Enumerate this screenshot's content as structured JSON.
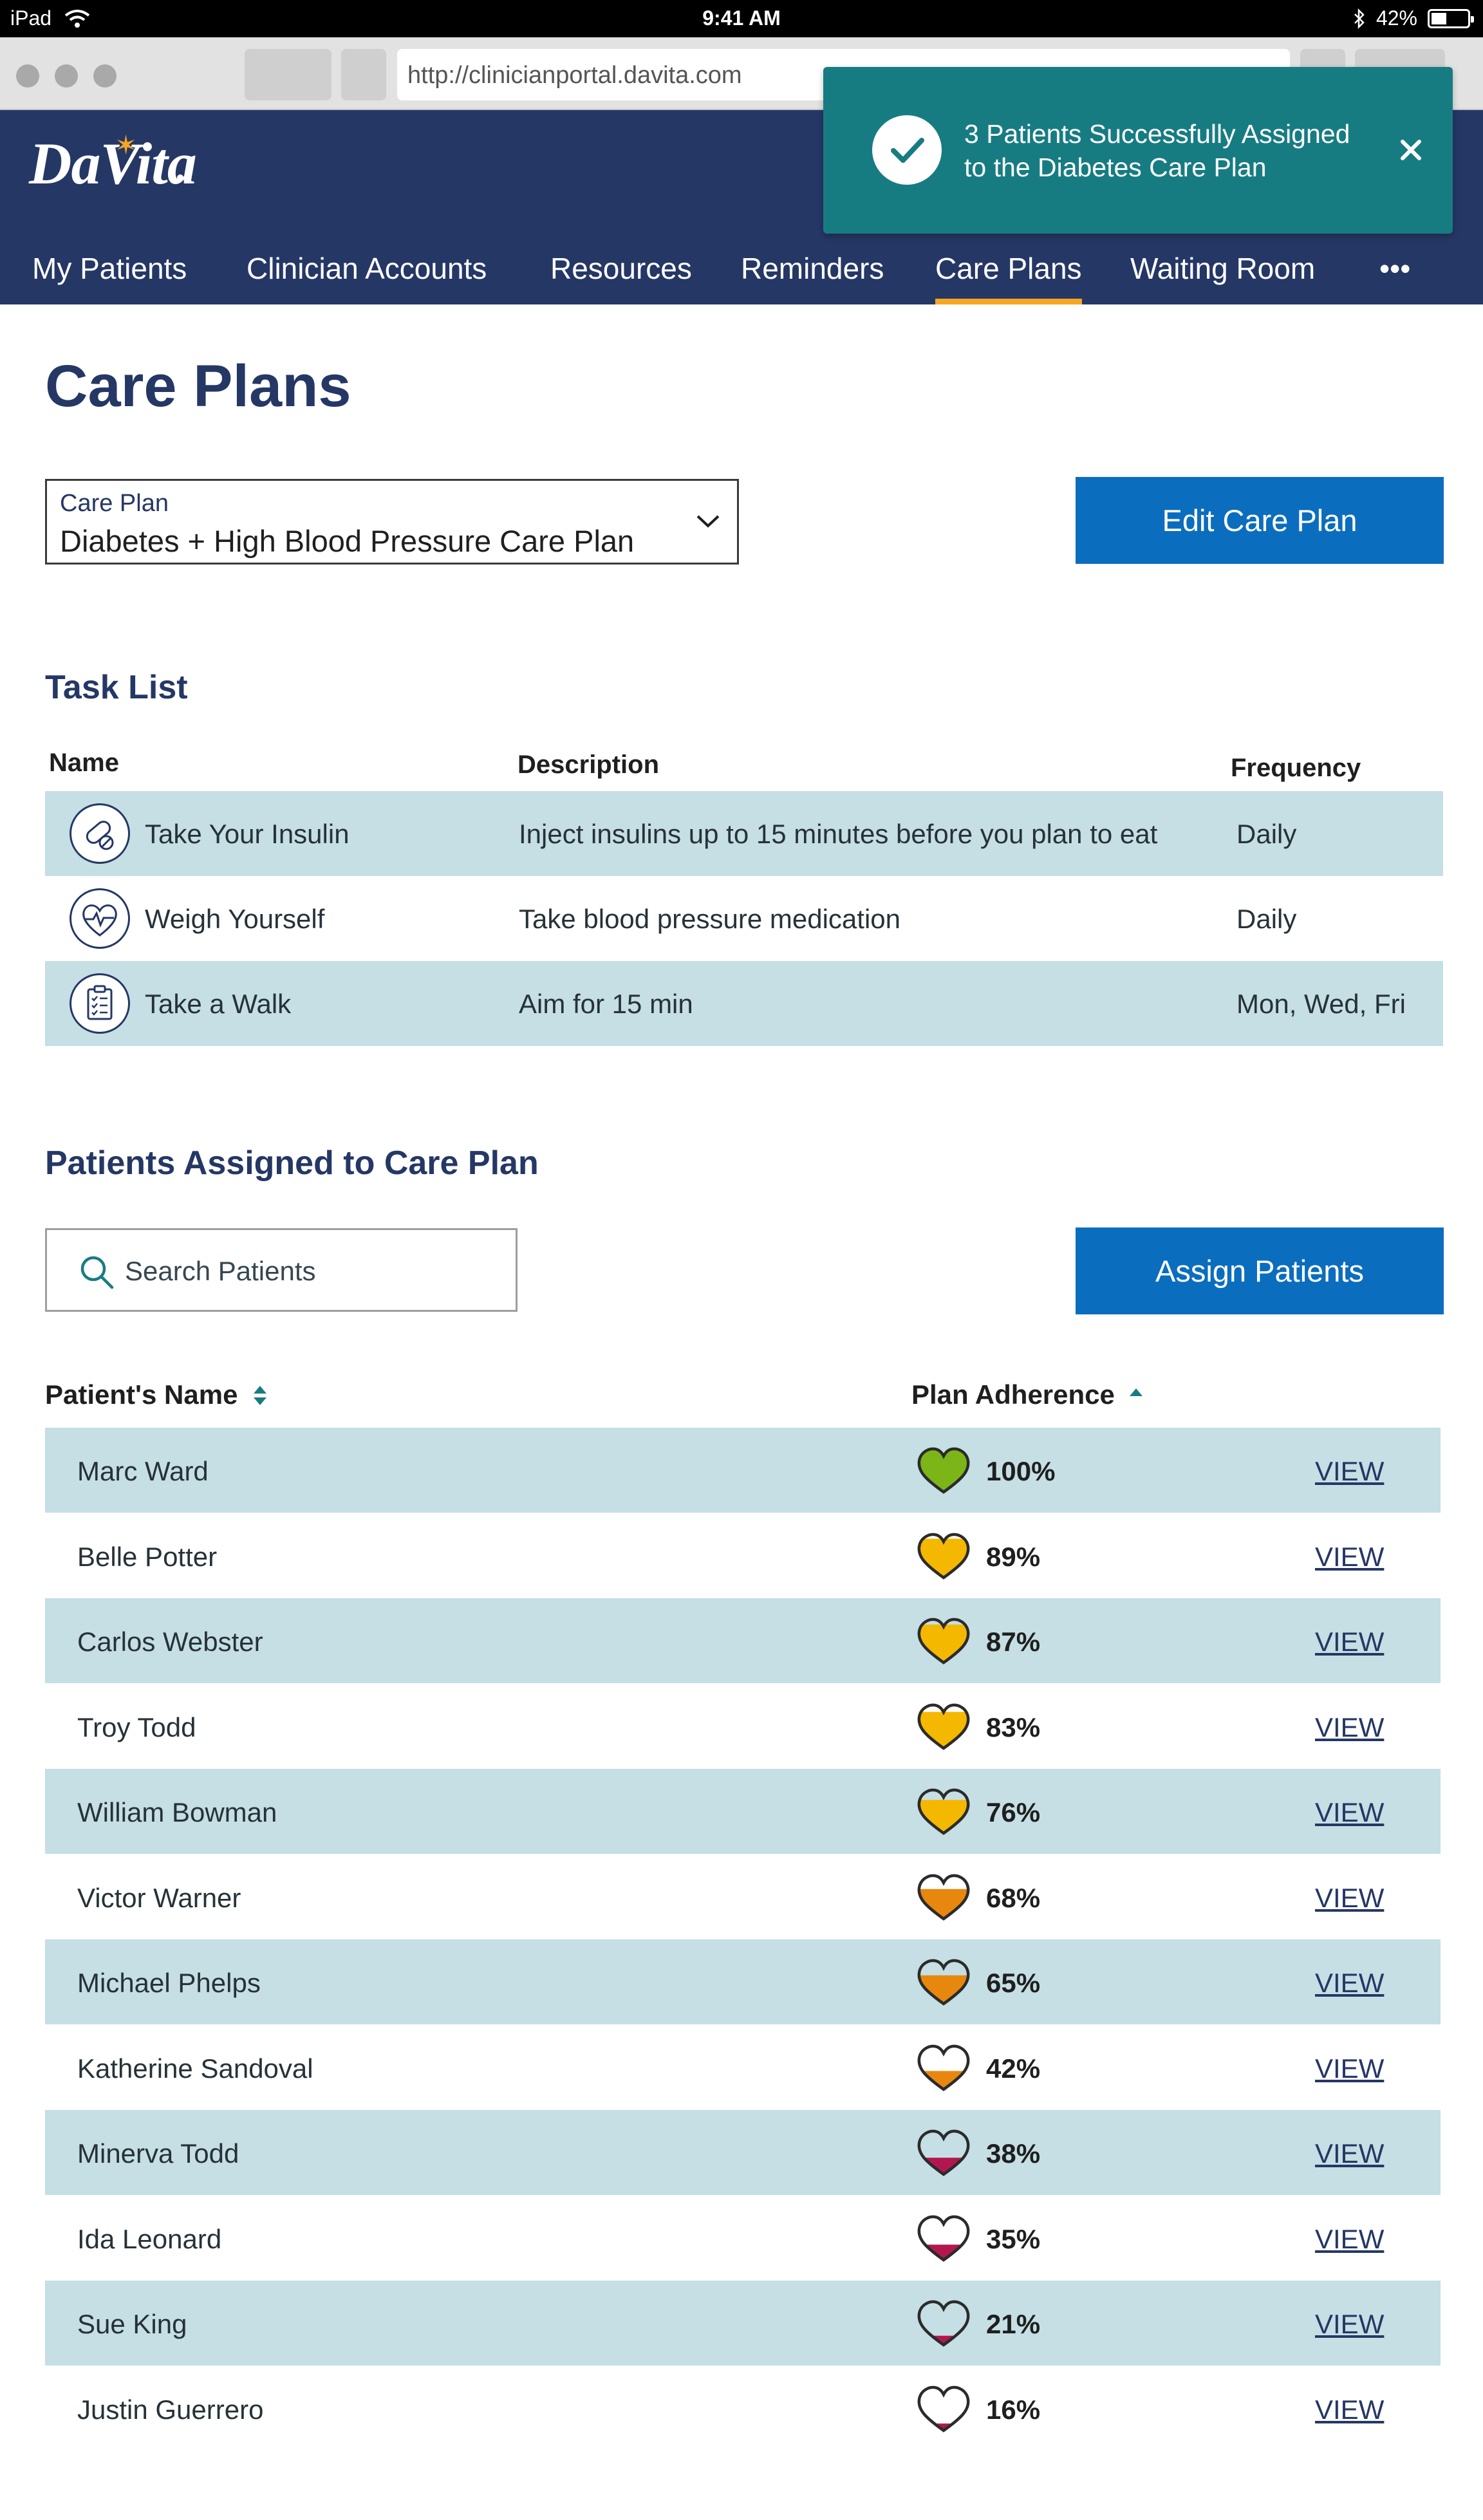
{
  "status_bar": {
    "device": "iPad",
    "time": "9:41 AM",
    "battery": "42%",
    "battery_level": 0.42
  },
  "browser": {
    "url": "http://clinicianportal.davita.com"
  },
  "header": {
    "logo": "DaVita",
    "nav": [
      {
        "label": "My Patients",
        "active": false
      },
      {
        "label": "Clinician Accounts",
        "active": false
      },
      {
        "label": "Resources",
        "active": false
      },
      {
        "label": "Reminders",
        "active": false
      },
      {
        "label": "Care Plans",
        "active": true
      },
      {
        "label": "Waiting Room",
        "active": false
      },
      {
        "label": "•••",
        "active": false
      }
    ],
    "accent_color": "#f5a623",
    "bg_color": "#253765"
  },
  "toast": {
    "message_line1": "3 Patients Successfully Assigned",
    "message_line2": "to the Diabetes Care Plan",
    "bg_color": "#177c82"
  },
  "page": {
    "title": "Care Plans",
    "care_plan_select": {
      "label": "Care Plan",
      "value": "Diabetes + High Blood Pressure Care Plan"
    },
    "edit_button": "Edit Care Plan"
  },
  "task_list": {
    "title": "Task List",
    "columns": {
      "name": "Name",
      "description": "Description",
      "frequency": "Frequency"
    },
    "rows": [
      {
        "icon": "pills-icon",
        "name": "Take Your Insulin",
        "description": "Inject insulins up to 15 minutes before you plan to eat",
        "frequency": "Daily"
      },
      {
        "icon": "heart-pulse-icon",
        "name": "Weigh Yourself",
        "description": "Take blood pressure medication",
        "frequency": "Daily"
      },
      {
        "icon": "clipboard-icon",
        "name": "Take a Walk",
        "description": "Aim for 15 min",
        "frequency": "Mon, Wed, Fri"
      }
    ]
  },
  "patients": {
    "title": "Patients Assigned to Care Plan",
    "search_placeholder": "Search Patients",
    "assign_button": "Assign Patients",
    "columns": {
      "name": "Patient's Name",
      "adherence": "Plan Adherence"
    },
    "view_label": "VIEW",
    "rows": [
      {
        "name": "Marc Ward",
        "adherence": "100%",
        "level": 1.0,
        "color": "#7cb518"
      },
      {
        "name": "Belle Potter",
        "adherence": "89%",
        "level": 0.89,
        "color": "#f5b800"
      },
      {
        "name": "Carlos Webster",
        "adherence": "87%",
        "level": 0.87,
        "color": "#f5b800"
      },
      {
        "name": "Troy Todd",
        "adherence": "83%",
        "level": 0.83,
        "color": "#f5b800"
      },
      {
        "name": "William Bowman",
        "adherence": "76%",
        "level": 0.76,
        "color": "#f5b800"
      },
      {
        "name": "Victor Warner",
        "adherence": "68%",
        "level": 0.68,
        "color": "#e8870e"
      },
      {
        "name": "Michael Phelps",
        "adherence": "65%",
        "level": 0.65,
        "color": "#e8870e"
      },
      {
        "name": "Katherine Sandoval",
        "adherence": "42%",
        "level": 0.42,
        "color": "#e8870e"
      },
      {
        "name": "Minerva Todd",
        "adherence": "38%",
        "level": 0.38,
        "color": "#b2184f"
      },
      {
        "name": "Ida Leonard",
        "adherence": "35%",
        "level": 0.35,
        "color": "#b2184f"
      },
      {
        "name": "Sue King",
        "adherence": "21%",
        "level": 0.21,
        "color": "#b2184f"
      },
      {
        "name": "Justin Guerrero",
        "adherence": "16%",
        "level": 0.16,
        "color": "#b2184f"
      }
    ]
  }
}
